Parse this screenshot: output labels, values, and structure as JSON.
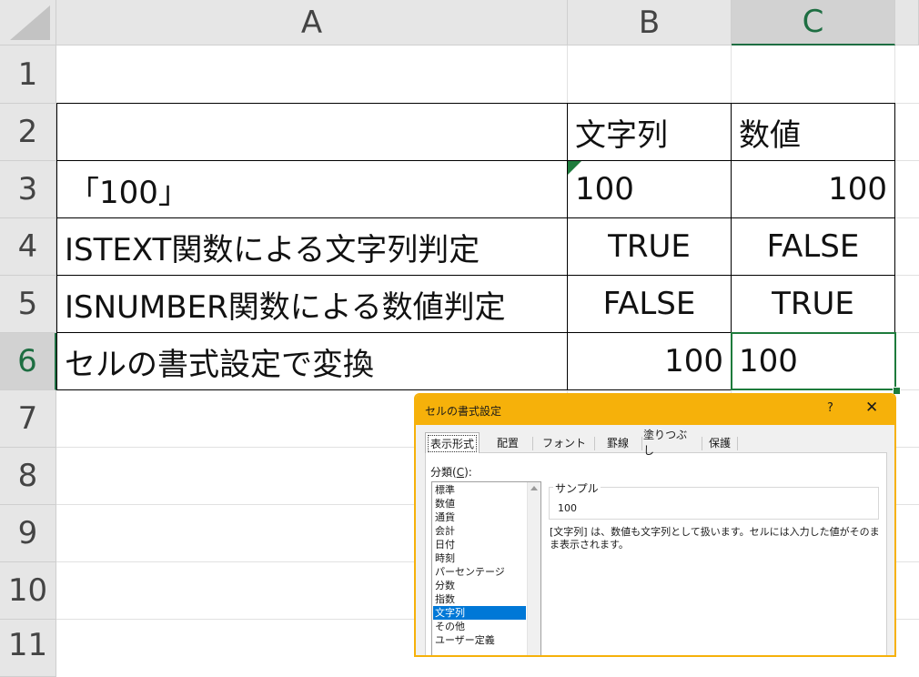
{
  "columns": [
    "A",
    "B",
    "C"
  ],
  "rows": [
    "1",
    "2",
    "3",
    "4",
    "5",
    "6",
    "7",
    "8",
    "9",
    "10",
    "11"
  ],
  "cells": {
    "B2": "文字列",
    "C2": "数値",
    "A3": "「100」",
    "B3": "100",
    "C3": "100",
    "A4": "ISTEXT関数による文字列判定",
    "B4": "TRUE",
    "C4": "FALSE",
    "A5": "ISNUMBER関数による数値判定",
    "B5": "FALSE",
    "C5": "TRUE",
    "A6": "セルの書式設定で変換",
    "B6": "100",
    "C6": "100"
  },
  "selection": {
    "active_cell": "C6"
  },
  "colors": {
    "accent_green": "#1e7b3c",
    "dialog_titlebar": "#f6b10a",
    "list_selection": "#0078d7"
  },
  "dialog": {
    "title": "セルの書式設定",
    "help_label": "?",
    "close_label": "✕",
    "tabs": [
      "表示形式",
      "配置",
      "フォント",
      "罫線",
      "塗りつぶし",
      "保護"
    ],
    "active_tab": "表示形式",
    "category_label_prefix": "分類(",
    "category_label_key": "C",
    "category_label_suffix": "):",
    "categories": [
      "標準",
      "数値",
      "通貨",
      "会計",
      "日付",
      "時刻",
      "パーセンテージ",
      "分数",
      "指数",
      "文字列",
      "その他",
      "ユーザー定義"
    ],
    "selected_category": "文字列",
    "sample_label": "サンプル",
    "sample_value": "100",
    "description": "[文字列] は、数値も文字列として扱います。セルには入力した値がそのまま表示されます。"
  }
}
